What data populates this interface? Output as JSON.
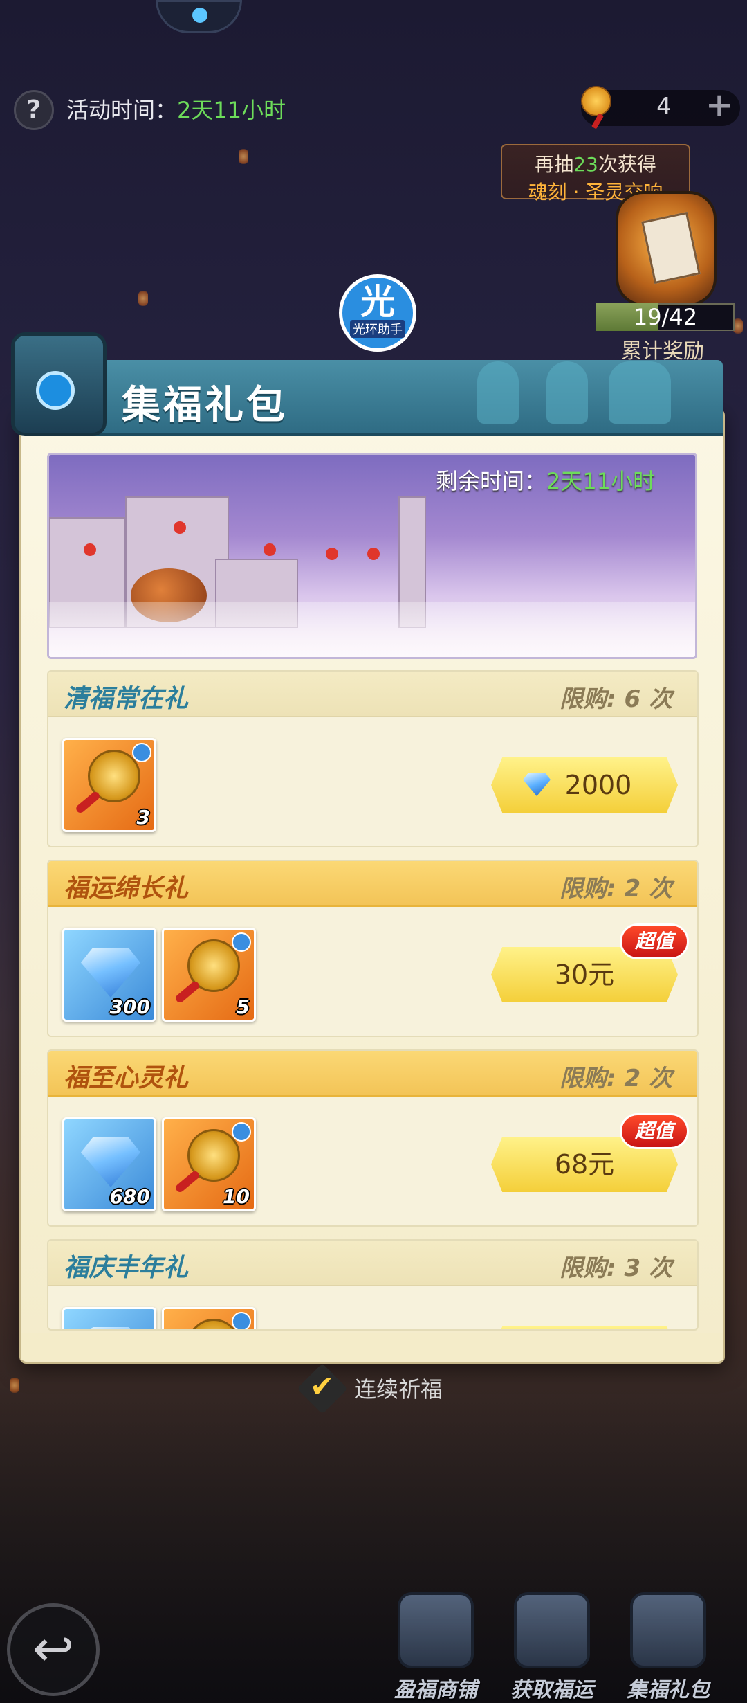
{
  "header": {
    "help_label": "?",
    "event_time_label": "活动时间：",
    "event_time_value": "2天11小时",
    "currency_value": "4",
    "currency_plus": "+",
    "draw_tip_prefix": "再抽",
    "draw_tip_count": "23",
    "draw_tip_suffix": "次获得",
    "draw_tip_reward": "魂刻 · 圣灵交响",
    "reward_progress_text": "19/42",
    "reward_progress_fraction": 0.4524,
    "reward_label": "累计奖励"
  },
  "helper": {
    "big": "光",
    "small": "光环助手"
  },
  "panel": {
    "title": "集福礼包",
    "banner_time_label": "剩余时间：",
    "banner_time_value": "2天11小时"
  },
  "packs": [
    {
      "name": "清福常在礼",
      "limit": "限购: 6 次",
      "style": "plain",
      "items": [
        {
          "type": "charm",
          "qty": "3"
        }
      ],
      "price": "2000",
      "price_currency": "gem",
      "hot": false
    },
    {
      "name": "福运绵长礼",
      "limit": "限购: 2 次",
      "style": "gold",
      "items": [
        {
          "type": "gem",
          "qty": "300"
        },
        {
          "type": "charm",
          "qty": "5"
        }
      ],
      "price": "30元",
      "price_currency": "rmb",
      "hot": true,
      "hot_label": "超值"
    },
    {
      "name": "福至心灵礼",
      "limit": "限购: 2 次",
      "style": "gold",
      "items": [
        {
          "type": "gem",
          "qty": "680"
        },
        {
          "type": "charm",
          "qty": "10"
        }
      ],
      "price": "68元",
      "price_currency": "rmb",
      "hot": true,
      "hot_label": "超值"
    },
    {
      "name": "福庆丰年礼",
      "limit": "限购: 3 次",
      "style": "plain",
      "items": [
        {
          "type": "gem",
          "qty": ""
        },
        {
          "type": "charm",
          "qty": ""
        }
      ],
      "price": "",
      "price_currency": "rmb",
      "hot": false
    }
  ],
  "footer": {
    "checkbox_label": "连续祈福",
    "back_label": "↩",
    "nav": [
      {
        "label": "盈福商铺"
      },
      {
        "label": "获取福运"
      },
      {
        "label": "集福礼包"
      }
    ]
  },
  "colors": {
    "accent_green": "#6ddc5a",
    "header_teal": "#2f6c84",
    "gold_row": "#f3c457",
    "price_button": "#f4cf3a",
    "hot_red": "#c81414"
  }
}
